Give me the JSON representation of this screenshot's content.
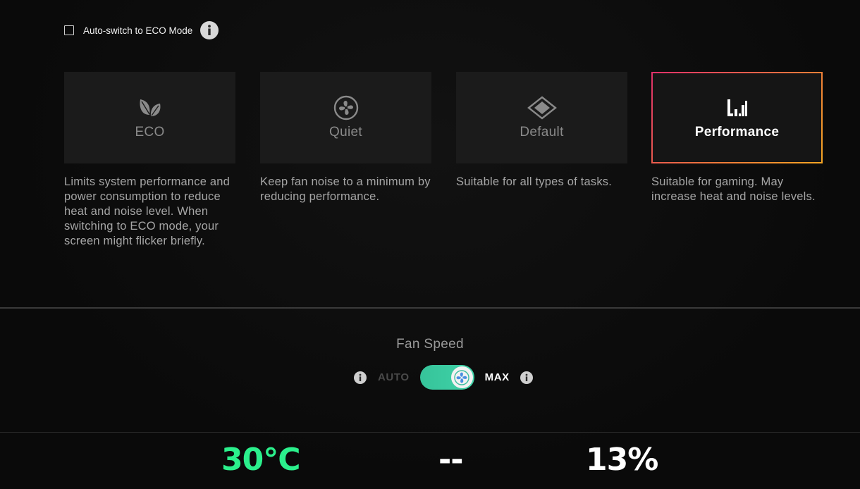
{
  "eco_auto_switch": {
    "label": "Auto-switch to ECO Mode",
    "checked": false,
    "info_icon": "info-icon"
  },
  "modes": [
    {
      "id": "eco",
      "label": "ECO",
      "icon": "leaf-icon",
      "description": "Limits system performance and power consumption to reduce heat and noise level. When switching to ECO mode, your screen might flicker briefly.",
      "selected": false
    },
    {
      "id": "quiet",
      "label": "Quiet",
      "icon": "fan-icon",
      "description": "Keep fan noise to a minimum by reducing performance.",
      "selected": false
    },
    {
      "id": "default",
      "label": "Default",
      "icon": "diamond-icon",
      "description": "Suitable for all types of tasks.",
      "selected": false
    },
    {
      "id": "performance",
      "label": "Performance",
      "icon": "performance-bars-icon",
      "description": "Suitable for gaming. May increase heat and noise levels.",
      "selected": true
    }
  ],
  "fan_speed": {
    "title": "Fan Speed",
    "auto_label": "AUTO",
    "max_label": "MAX",
    "toggle_state": "MAX"
  },
  "stats": {
    "temperature": "30°C",
    "middle": "--",
    "percent": "13%"
  },
  "colors": {
    "accent_green": "#2bf08c",
    "toggle_green": "#3cc9a0",
    "active_border_start": "#e0306a",
    "active_border_end": "#f5a623"
  }
}
